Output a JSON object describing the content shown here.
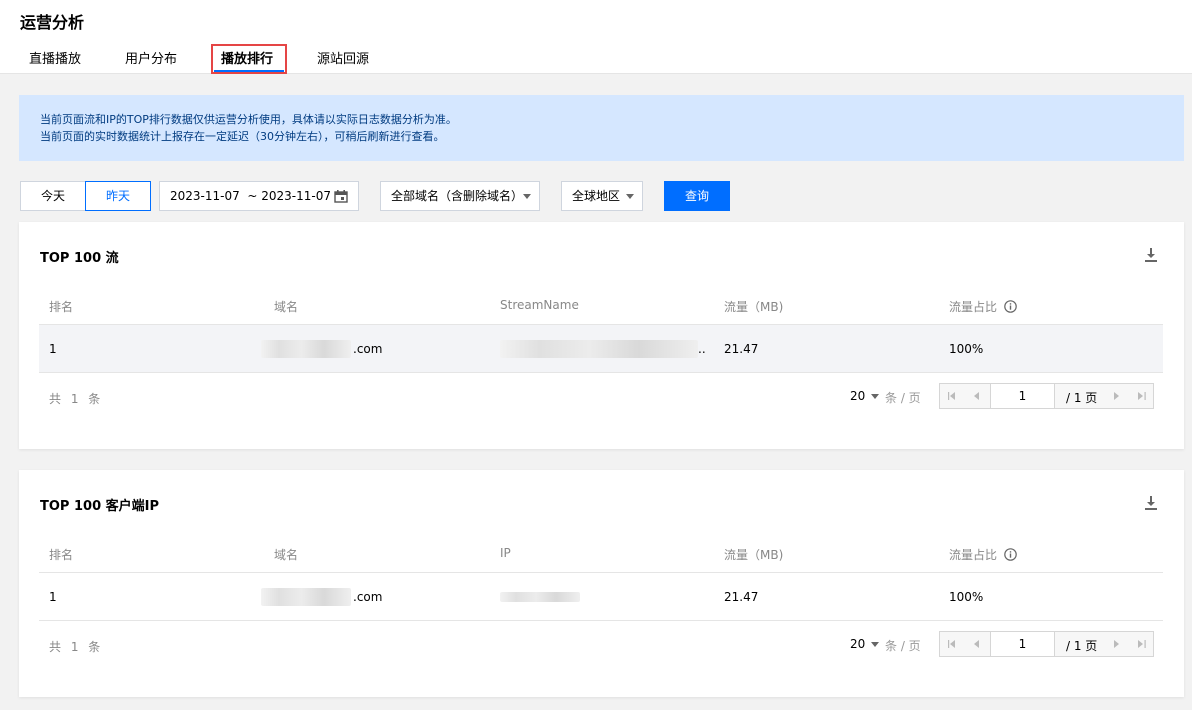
{
  "page": {
    "title": "运营分析",
    "tabs": [
      "直播播放",
      "用户分布",
      "播放排行",
      "源站回源"
    ]
  },
  "notice": {
    "line1": "当前页面流和IP的TOP排行数据仅供运营分析使用，具体请以实际日志数据分析为准。",
    "line2": "当前页面的实时数据统计上报存在一定延迟（30分钟左右），可稍后刷新进行查看。"
  },
  "filters": {
    "today": "今天",
    "yesterday": "昨天",
    "date_range": "2023-11-07  ~ 2023-11-07",
    "domain": "全部域名（含删除域名）",
    "region": "全球地区",
    "query": "查询"
  },
  "stream_table": {
    "title": "TOP 100 流",
    "headers": [
      "排名",
      "域名",
      "StreamName",
      "流量（MB)",
      "流量占比"
    ],
    "rows": [
      {
        "rank": "1",
        "domain_suffix": ".com",
        "stream_suffix": "..",
        "traffic": "21.47",
        "ratio": "100%"
      }
    ],
    "total": "共 1 条",
    "page_size": "20",
    "per_page": "条 / 页",
    "current_page": "1",
    "total_pages": "/ 1 页"
  },
  "ip_table": {
    "title": "TOP 100 客户端IP",
    "headers": [
      "排名",
      "域名",
      "IP",
      "流量（MB)",
      "流量占比"
    ],
    "rows": [
      {
        "rank": "1",
        "domain_suffix": ".com",
        "traffic": "21.47",
        "ratio": "100%"
      }
    ],
    "total": "共 1 条",
    "page_size": "20",
    "per_page": "条 / 页",
    "current_page": "1",
    "total_pages": "/ 1 页"
  }
}
